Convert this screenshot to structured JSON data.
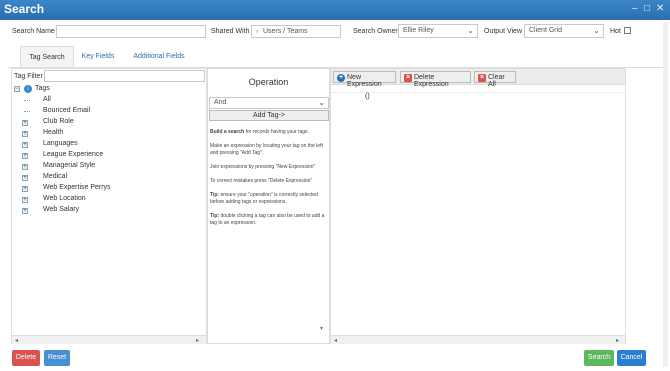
{
  "window": {
    "title": "Search",
    "minimize_glyph": "–",
    "maximize_glyph": "□",
    "close_glyph": "✕"
  },
  "search_bar": {
    "name_label": "Search Name",
    "name_value": "",
    "shared_label": "Shared With",
    "shared_value": "Users / Teams",
    "owner_label": "Search Owner",
    "owner_value": "Ellie Riley",
    "output_label": "Output View",
    "output_value": "Client Grid",
    "hot_label": "Hot",
    "hot_checked": false
  },
  "tabs": [
    {
      "label": "Tag Search",
      "active": true
    },
    {
      "label": "Key Fields",
      "active": false
    },
    {
      "label": "Additional Fields",
      "active": false
    }
  ],
  "tag_tree": {
    "filter_label": "Tag Filter",
    "filter_value": "",
    "root": "Tags",
    "items": [
      {
        "label": "All",
        "expandable": false
      },
      {
        "label": "Bounced Email",
        "expandable": false
      },
      {
        "label": "Club Role",
        "expandable": true
      },
      {
        "label": "Health",
        "expandable": true
      },
      {
        "label": "Languages",
        "expandable": true
      },
      {
        "label": "League Experience",
        "expandable": true
      },
      {
        "label": "Managerial Style",
        "expandable": true
      },
      {
        "label": "Medical",
        "expandable": true
      },
      {
        "label": "Web Expertise Perrys",
        "expandable": true
      },
      {
        "label": "Web Location",
        "expandable": true
      },
      {
        "label": "Web Salary",
        "expandable": true
      }
    ]
  },
  "operation": {
    "heading": "Operation",
    "select_value": "And",
    "add_tag_label": "Add Tag->",
    "help": [
      {
        "bold": "Build a search",
        "text": " for records having your tags."
      },
      {
        "bold": "",
        "text": "Make an expression by locating your tag on the left and pressing \"Add Tag\"."
      },
      {
        "bold": "",
        "text": "Join expressions by pressing \"New Expression\""
      },
      {
        "bold": "",
        "text": "To correct mistakes press \"Delete Expression\""
      },
      {
        "bold": "Tip:",
        "text": " ensure your \"operation\" is correctly selected before adding tags or expressions."
      },
      {
        "bold": "Tip:",
        "text": " double clicking a tag can also be used to add a tag to an expression."
      }
    ]
  },
  "expression": {
    "new_label": "New Expression",
    "delete_label": "Delete Expression",
    "clear_label": "Clear All",
    "content": "()"
  },
  "footer": {
    "delete_label": "Delete",
    "reset_label": "Reset",
    "search_label": "Search",
    "cancel_label": "Cancel"
  },
  "colors": {
    "titlebar": "#2a6fb0",
    "delete": "#d9534f",
    "reset": "#4a8fd4",
    "search": "#5cb85c",
    "cancel": "#2a7fd0"
  }
}
